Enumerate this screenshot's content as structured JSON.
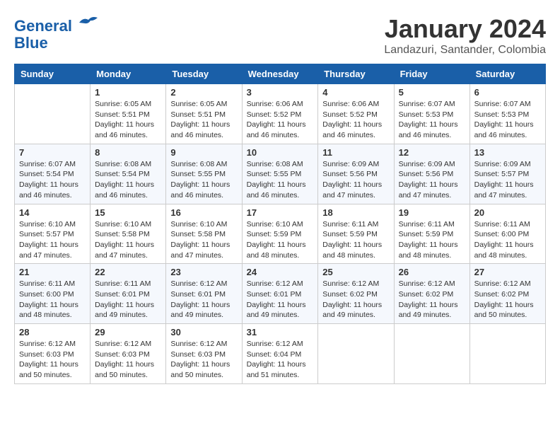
{
  "header": {
    "logo_line1": "General",
    "logo_line2": "Blue",
    "month_title": "January 2024",
    "location": "Landazuri, Santander, Colombia"
  },
  "days_of_week": [
    "Sunday",
    "Monday",
    "Tuesday",
    "Wednesday",
    "Thursday",
    "Friday",
    "Saturday"
  ],
  "weeks": [
    [
      {
        "day": "",
        "info": ""
      },
      {
        "day": "1",
        "info": "Sunrise: 6:05 AM\nSunset: 5:51 PM\nDaylight: 11 hours and 46 minutes."
      },
      {
        "day": "2",
        "info": "Sunrise: 6:05 AM\nSunset: 5:51 PM\nDaylight: 11 hours and 46 minutes."
      },
      {
        "day": "3",
        "info": "Sunrise: 6:06 AM\nSunset: 5:52 PM\nDaylight: 11 hours and 46 minutes."
      },
      {
        "day": "4",
        "info": "Sunrise: 6:06 AM\nSunset: 5:52 PM\nDaylight: 11 hours and 46 minutes."
      },
      {
        "day": "5",
        "info": "Sunrise: 6:07 AM\nSunset: 5:53 PM\nDaylight: 11 hours and 46 minutes."
      },
      {
        "day": "6",
        "info": "Sunrise: 6:07 AM\nSunset: 5:53 PM\nDaylight: 11 hours and 46 minutes."
      }
    ],
    [
      {
        "day": "7",
        "info": "Sunrise: 6:07 AM\nSunset: 5:54 PM\nDaylight: 11 hours and 46 minutes."
      },
      {
        "day": "8",
        "info": "Sunrise: 6:08 AM\nSunset: 5:54 PM\nDaylight: 11 hours and 46 minutes."
      },
      {
        "day": "9",
        "info": "Sunrise: 6:08 AM\nSunset: 5:55 PM\nDaylight: 11 hours and 46 minutes."
      },
      {
        "day": "10",
        "info": "Sunrise: 6:08 AM\nSunset: 5:55 PM\nDaylight: 11 hours and 46 minutes."
      },
      {
        "day": "11",
        "info": "Sunrise: 6:09 AM\nSunset: 5:56 PM\nDaylight: 11 hours and 47 minutes."
      },
      {
        "day": "12",
        "info": "Sunrise: 6:09 AM\nSunset: 5:56 PM\nDaylight: 11 hours and 47 minutes."
      },
      {
        "day": "13",
        "info": "Sunrise: 6:09 AM\nSunset: 5:57 PM\nDaylight: 11 hours and 47 minutes."
      }
    ],
    [
      {
        "day": "14",
        "info": "Sunrise: 6:10 AM\nSunset: 5:57 PM\nDaylight: 11 hours and 47 minutes."
      },
      {
        "day": "15",
        "info": "Sunrise: 6:10 AM\nSunset: 5:58 PM\nDaylight: 11 hours and 47 minutes."
      },
      {
        "day": "16",
        "info": "Sunrise: 6:10 AM\nSunset: 5:58 PM\nDaylight: 11 hours and 47 minutes."
      },
      {
        "day": "17",
        "info": "Sunrise: 6:10 AM\nSunset: 5:59 PM\nDaylight: 11 hours and 48 minutes."
      },
      {
        "day": "18",
        "info": "Sunrise: 6:11 AM\nSunset: 5:59 PM\nDaylight: 11 hours and 48 minutes."
      },
      {
        "day": "19",
        "info": "Sunrise: 6:11 AM\nSunset: 5:59 PM\nDaylight: 11 hours and 48 minutes."
      },
      {
        "day": "20",
        "info": "Sunrise: 6:11 AM\nSunset: 6:00 PM\nDaylight: 11 hours and 48 minutes."
      }
    ],
    [
      {
        "day": "21",
        "info": "Sunrise: 6:11 AM\nSunset: 6:00 PM\nDaylight: 11 hours and 48 minutes."
      },
      {
        "day": "22",
        "info": "Sunrise: 6:11 AM\nSunset: 6:01 PM\nDaylight: 11 hours and 49 minutes."
      },
      {
        "day": "23",
        "info": "Sunrise: 6:12 AM\nSunset: 6:01 PM\nDaylight: 11 hours and 49 minutes."
      },
      {
        "day": "24",
        "info": "Sunrise: 6:12 AM\nSunset: 6:01 PM\nDaylight: 11 hours and 49 minutes."
      },
      {
        "day": "25",
        "info": "Sunrise: 6:12 AM\nSunset: 6:02 PM\nDaylight: 11 hours and 49 minutes."
      },
      {
        "day": "26",
        "info": "Sunrise: 6:12 AM\nSunset: 6:02 PM\nDaylight: 11 hours and 49 minutes."
      },
      {
        "day": "27",
        "info": "Sunrise: 6:12 AM\nSunset: 6:02 PM\nDaylight: 11 hours and 50 minutes."
      }
    ],
    [
      {
        "day": "28",
        "info": "Sunrise: 6:12 AM\nSunset: 6:03 PM\nDaylight: 11 hours and 50 minutes."
      },
      {
        "day": "29",
        "info": "Sunrise: 6:12 AM\nSunset: 6:03 PM\nDaylight: 11 hours and 50 minutes."
      },
      {
        "day": "30",
        "info": "Sunrise: 6:12 AM\nSunset: 6:03 PM\nDaylight: 11 hours and 50 minutes."
      },
      {
        "day": "31",
        "info": "Sunrise: 6:12 AM\nSunset: 6:04 PM\nDaylight: 11 hours and 51 minutes."
      },
      {
        "day": "",
        "info": ""
      },
      {
        "day": "",
        "info": ""
      },
      {
        "day": "",
        "info": ""
      }
    ]
  ]
}
